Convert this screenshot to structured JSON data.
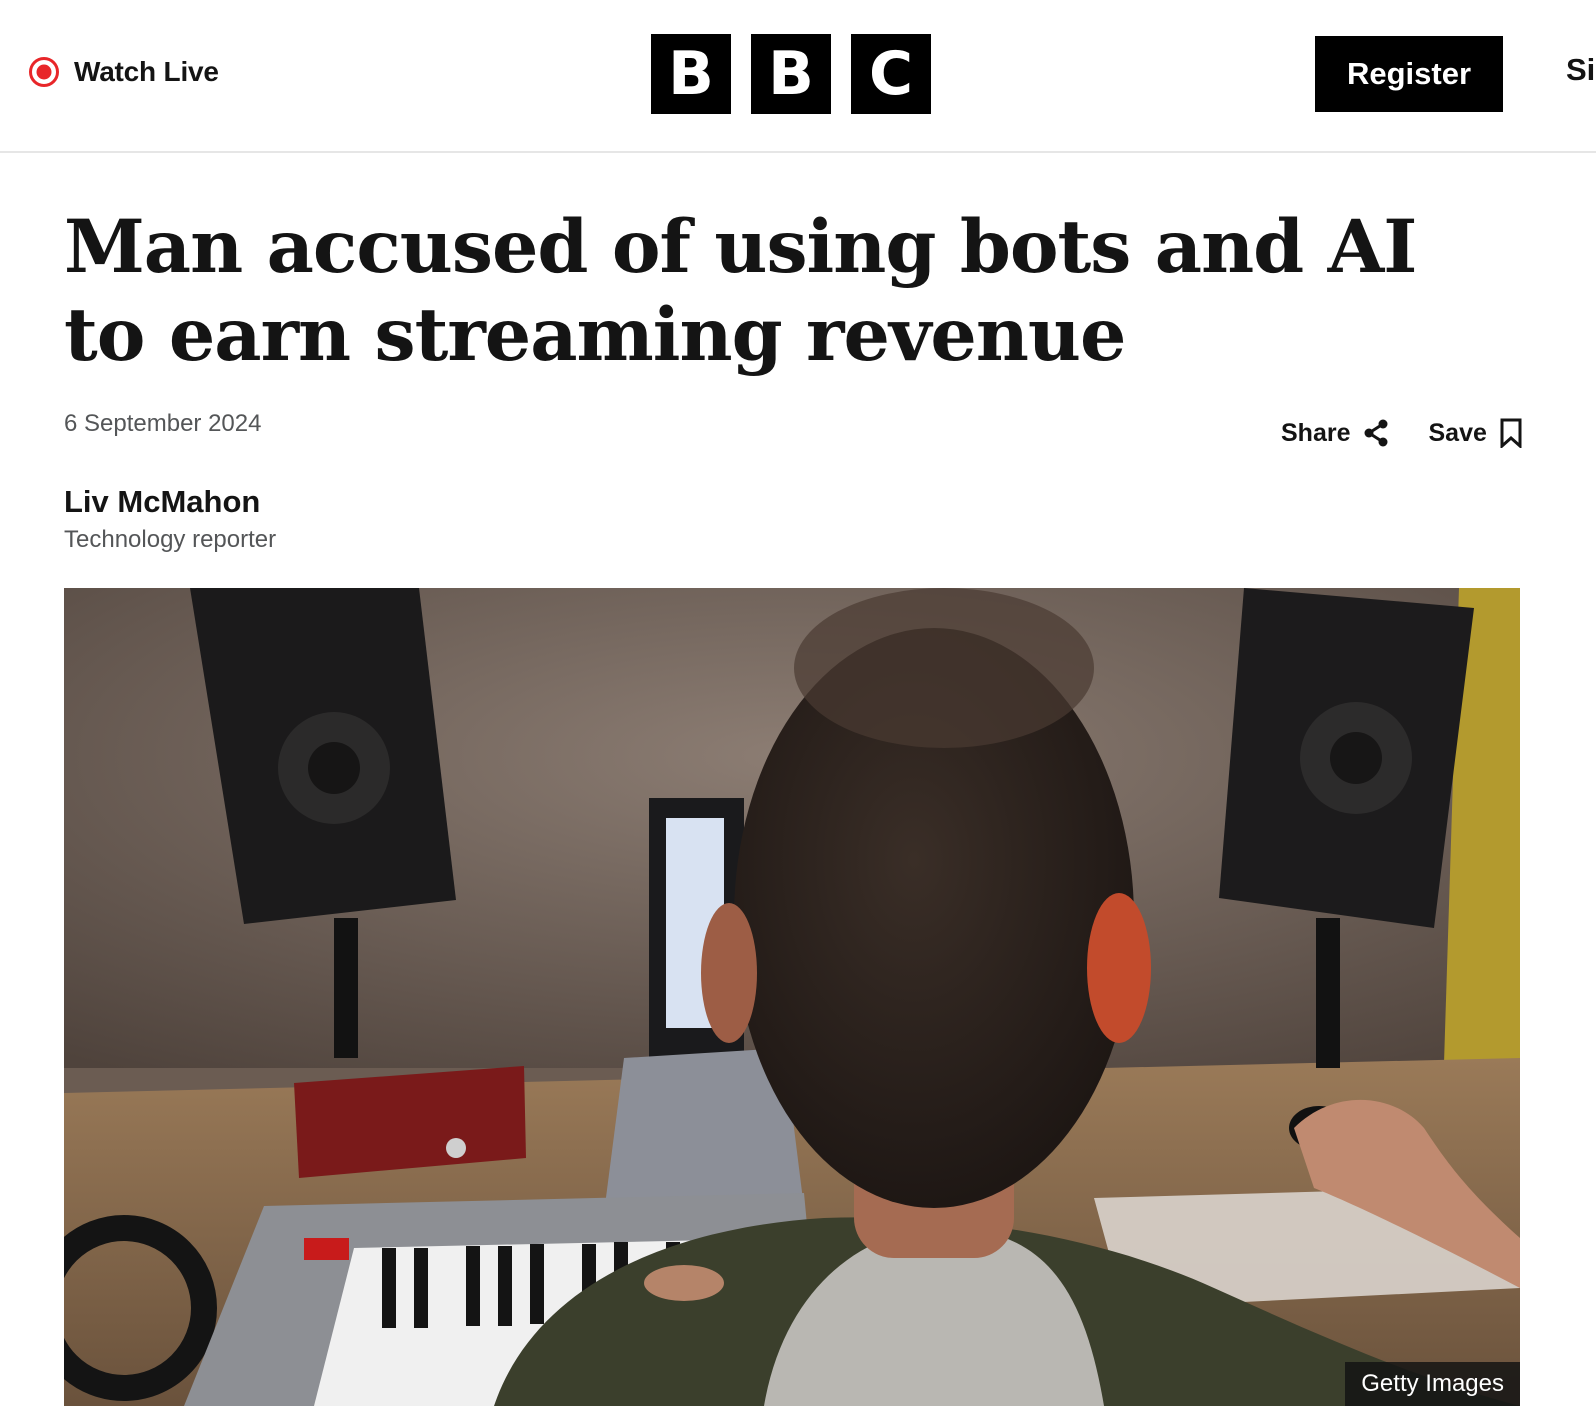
{
  "header": {
    "watch_live_label": "Watch Live",
    "logo_letters": [
      "B",
      "B",
      "C"
    ],
    "register_label": "Register",
    "signin_label": "Si"
  },
  "article": {
    "headline": "Man accused of using bots and AI to earn streaming revenue",
    "date": "6 September 2024",
    "share_label": "Share",
    "save_label": "Save",
    "author_name": "Liv McMahon",
    "author_role": "Technology reporter",
    "image_credit": "Getty Images"
  },
  "colors": {
    "live_red": "#e82629",
    "text": "#141414",
    "meta_grey": "#545658",
    "brand_black": "#000000"
  },
  "icons": {
    "live": "live-record-icon",
    "share": "share-icon",
    "save": "bookmark-icon"
  }
}
